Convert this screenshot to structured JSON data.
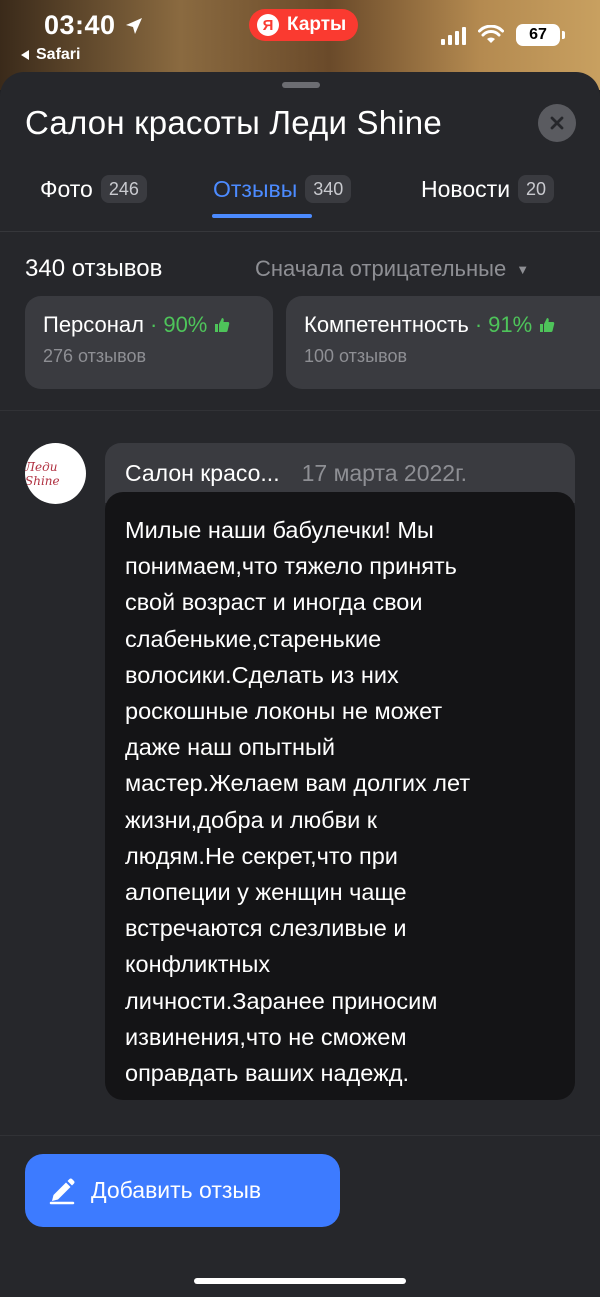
{
  "status_bar": {
    "time": "03:40",
    "back_app": "Safari",
    "app_badge": "Карты",
    "app_badge_logo": "Я",
    "battery": "67"
  },
  "header": {
    "title": "Салон красоты Леди Shine"
  },
  "tabs": [
    {
      "label": "Фото",
      "count": "246"
    },
    {
      "label": "Отзывы",
      "count": "340"
    },
    {
      "label": "Новости",
      "count": "20"
    }
  ],
  "reviews": {
    "count_label": "340 отзывов",
    "sort_label": "Сначала отрицательные"
  },
  "aspects": [
    {
      "name": "Персонал",
      "percent": "90%",
      "sub": "276 отзывов"
    },
    {
      "name": "Компетентность",
      "percent": "91%",
      "sub": "100 отзывов"
    }
  ],
  "reply": {
    "avatar_text": "Леди Shine",
    "author": "Салон красо...",
    "date": "17 марта 2022г.",
    "text": "Милые наши бабулечки! Мы\nпонимаем,что тяжело принять\nсвой возраст и иногда свои\nслабенькие,старенькие\nволосики.Сделать из них\nроскошные локоны не может\nдаже наш опытный\nмастер.Желаем вам долгих лет\nжизни,добра и любви к\nлюдям.Не секрет,что при\nалопеции у женщин чаще\nвстречаются слезливые и\nконфликтных\nличности.Заранее приносим\nизвинения,что не сможем\nоправдать ваших надежд."
  },
  "actions": {
    "add_review": "Добавить отзыв"
  },
  "colors": {
    "accent": "#4c8bff",
    "positive": "#4ec45a",
    "button": "#3d7bff",
    "yandex_red": "#fa3a30"
  }
}
